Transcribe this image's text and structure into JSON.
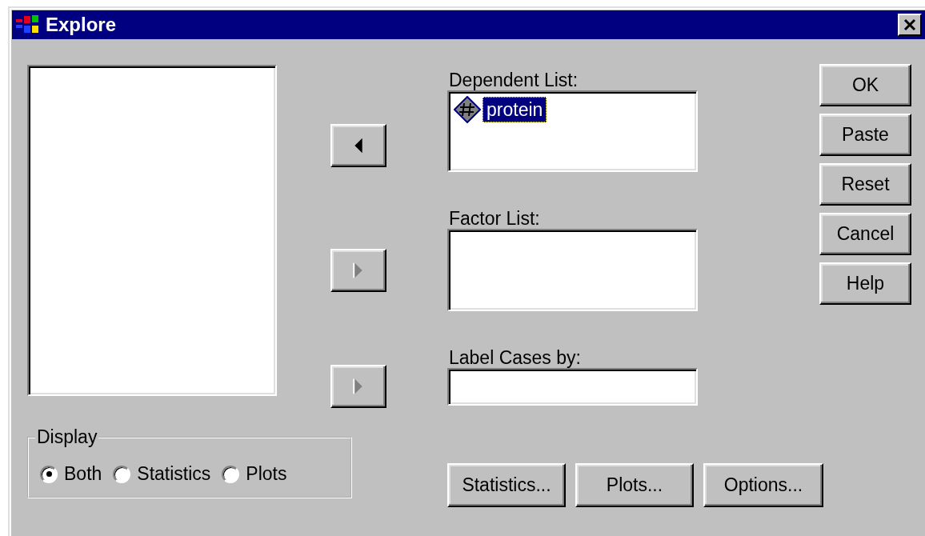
{
  "window": {
    "title": "Explore"
  },
  "source_list": {
    "kind": "listbox"
  },
  "move_buttons": [
    {
      "kind": "left",
      "disabled": false
    },
    {
      "kind": "right",
      "disabled": true
    },
    {
      "kind": "right",
      "disabled": true
    }
  ],
  "dependent_list": {
    "label": "Dependent List:",
    "items": [
      {
        "name": "protein",
        "selected": true
      }
    ]
  },
  "factor_list": {
    "label": "Factor List:"
  },
  "label_cases": {
    "label": "Label Cases by:"
  },
  "dialog_buttons": [
    {
      "label": "OK"
    },
    {
      "label": "Paste"
    },
    {
      "label": "Reset"
    },
    {
      "label": "Cancel"
    },
    {
      "label": "Help"
    }
  ],
  "display": {
    "title": "Display",
    "options": [
      {
        "label": "Both",
        "selected": true
      },
      {
        "label": "Statistics",
        "selected": false
      },
      {
        "label": "Plots",
        "selected": false
      }
    ]
  },
  "sub_buttons": [
    {
      "label": "Statistics..."
    },
    {
      "label": "Plots..."
    },
    {
      "label": "Options..."
    }
  ]
}
